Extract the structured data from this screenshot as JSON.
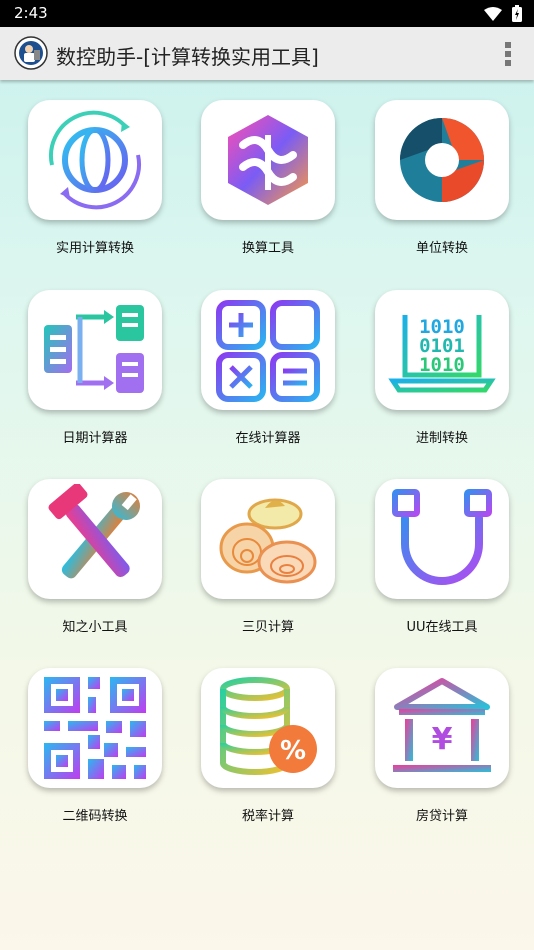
{
  "status_bar": {
    "time": "2:43"
  },
  "app_bar": {
    "title": "数控助手-[计算转换实用工具]"
  },
  "tools": [
    {
      "label": "实用计算转换",
      "icon": "globe-icon"
    },
    {
      "label": "换算工具",
      "icon": "ribbon-logo-icon"
    },
    {
      "label": "单位转换",
      "icon": "aperture-icon"
    },
    {
      "label": "日期计算器",
      "icon": "flow-transfer-icon"
    },
    {
      "label": "在线计算器",
      "icon": "calculator-icon"
    },
    {
      "label": "进制转换",
      "icon": "binary-laptop-icon"
    },
    {
      "label": "知之小工具",
      "icon": "hammer-wrench-icon"
    },
    {
      "label": "三贝计算",
      "icon": "shells-icon"
    },
    {
      "label": "UU在线工具",
      "icon": "magnet-icon"
    },
    {
      "label": "二维码转换",
      "icon": "qr-code-icon"
    },
    {
      "label": "税率计算",
      "icon": "coins-percent-icon"
    },
    {
      "label": "房贷计算",
      "icon": "bank-yuan-icon"
    }
  ]
}
